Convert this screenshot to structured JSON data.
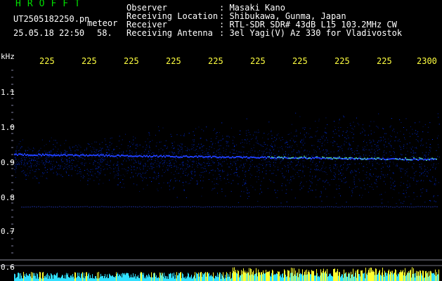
{
  "station": {
    "logo": "HROFFT",
    "filename": "UT2505182250.pn",
    "type": "meteor",
    "datetime": "25.05.18 22:50",
    "count": "58."
  },
  "header": {
    "observer_label": "Observer",
    "observer_value": ": Masaki Kano",
    "location_label": "Receiving Location",
    "location_value": ": Shibukawa, Gunma, Japan",
    "receiver_label": "Receiver",
    "receiver_value": ": RTL-SDR SDR# 43dB L15 103.2MHz CW",
    "antenna_label": "Receiving Antenna",
    "antenna_value": ": 3el Yagi(V) Az 330 for Vladivostok"
  },
  "axis": {
    "y_unit": "kHz",
    "y_ticks": [
      "1.1",
      "1.0",
      "0.9",
      "0.8",
      "0.7",
      "0.6"
    ],
    "x_ticks": [
      "225",
      "225",
      "225",
      "225",
      "225",
      "225",
      "225",
      "225",
      "225",
      "2300"
    ]
  },
  "colors": {
    "header_green": "#00e000",
    "tick_yellow": "#ffff40",
    "signal_blue": "#2040ff",
    "signal_core": "#60ff90",
    "tick_grey": "#8080a0"
  }
}
